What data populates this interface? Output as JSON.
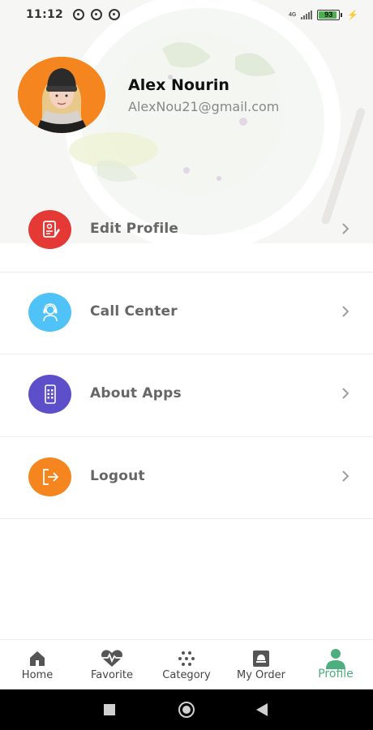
{
  "status_bar": {
    "time": "11:12",
    "network": "4G",
    "battery": "93",
    "battery_level": 0.93
  },
  "profile": {
    "name": "Alex Nourin",
    "email": "AlexNou21@gmail.com",
    "avatar_bg": "#f5851f"
  },
  "menu": {
    "items": [
      {
        "label": "Edit Profile",
        "icon": "edit-profile-icon",
        "color": "#e53935"
      },
      {
        "label": "Call Center",
        "icon": "headset-icon",
        "color": "#4fc3f7"
      },
      {
        "label": "About Apps",
        "icon": "phone-apps-icon",
        "color": "#5c4fc9"
      },
      {
        "label": "Logout",
        "icon": "logout-icon",
        "color": "#f5861f"
      }
    ]
  },
  "bottom_nav": {
    "items": [
      {
        "label": "Home",
        "icon": "home-icon",
        "active": false
      },
      {
        "label": "Favorite",
        "icon": "heart-pulse-icon",
        "active": false
      },
      {
        "label": "Category",
        "icon": "category-dots-icon",
        "active": false
      },
      {
        "label": "My Order",
        "icon": "order-icon",
        "active": false
      },
      {
        "label": "Profile",
        "icon": "user-icon",
        "active": true
      }
    ],
    "active_color": "#4caf7d"
  },
  "system_nav": {
    "buttons": [
      "recent-apps-icon",
      "home-circle-icon",
      "back-icon"
    ]
  }
}
